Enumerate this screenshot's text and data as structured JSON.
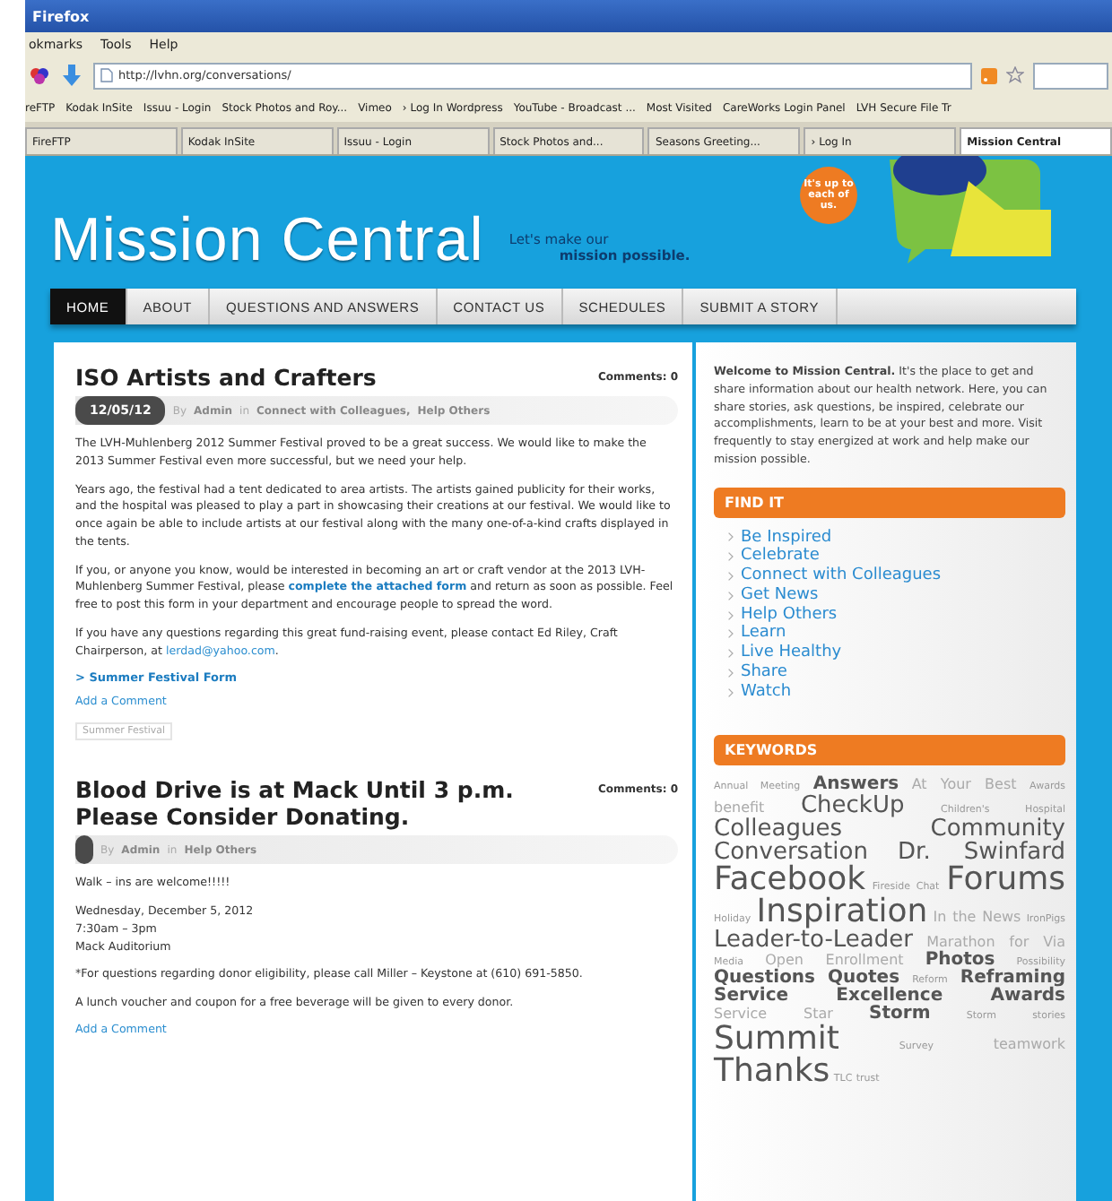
{
  "browser": {
    "title": "Firefox",
    "menu": [
      "okmarks",
      "Tools",
      "Help"
    ],
    "address": "http://lvhn.org/conversations/",
    "bookmarks": [
      "reFTP",
      "Kodak InSite",
      "Issuu - Login",
      "Stock Photos and Roy...",
      "Vimeo",
      "› Log In Wordpress",
      "YouTube - Broadcast ...",
      "Most Visited",
      "CareWorks Login Panel",
      "LVH Secure File Tr"
    ],
    "tabs": [
      {
        "label": "FireFTP",
        "selected": false
      },
      {
        "label": "Kodak InSite",
        "selected": false
      },
      {
        "label": "Issuu - Login",
        "selected": false
      },
      {
        "label": "Stock Photos and...",
        "selected": false
      },
      {
        "label": "Seasons Greeting...",
        "selected": false
      },
      {
        "label": "› Log In",
        "selected": false
      },
      {
        "label": "Mission Central",
        "selected": true
      }
    ]
  },
  "header": {
    "title": "Mission Central",
    "tagline_1": "Let's make our",
    "tagline_2": "mission possible.",
    "bubble": "It's up to each of us."
  },
  "nav": [
    {
      "label": "HOME",
      "selected": true
    },
    {
      "label": "ABOUT",
      "selected": false
    },
    {
      "label": "QUESTIONS AND ANSWERS",
      "selected": false
    },
    {
      "label": "CONTACT US",
      "selected": false
    },
    {
      "label": "SCHEDULES",
      "selected": false
    },
    {
      "label": "SUBMIT A STORY",
      "selected": false
    }
  ],
  "posts": [
    {
      "title": "ISO Artists and Crafters",
      "comments": "Comments: 0",
      "date": "12/05/12",
      "by": "By",
      "author": "Admin",
      "in": "in",
      "categories": [
        "Connect with Colleagues,",
        "Help Others"
      ],
      "paragraphs": [
        {
          "lines": [
            [
              {
                "kind": "text",
                "text": "The LVH-Muhlenberg 2012 Summer Festival proved to be a great success. We would like to make the 2013 Summer Festival even more successful, but we need your help."
              }
            ]
          ]
        },
        {
          "lines": [
            [
              {
                "kind": "text",
                "text": "Years ago, the festival had a tent dedicated to area artists. The artists gained publicity for their works, and the hospital was pleased to play a part in showcasing their creations at our festival. We would like to once again be able to include artists at our festival along with the many one-of-a-kind crafts displayed in the tents."
              }
            ]
          ]
        },
        {
          "lines": [
            [
              {
                "kind": "text",
                "text": "If you, or anyone you know, would be interested in becoming an art or craft vendor at the 2013 LVH-Muhlenberg Summer Festival, please "
              },
              {
                "kind": "link",
                "text": "complete the attached form"
              },
              {
                "kind": "text",
                "text": " and return as soon as possible. Feel free to post this form in your department and encourage people to spread the word."
              }
            ]
          ]
        },
        {
          "lines": [
            [
              {
                "kind": "text",
                "text": "If you have any questions regarding this great fund-raising event, please contact Ed Riley, Craft Chairperson, at "
              },
              {
                "kind": "link",
                "text": "lerdad@yahoo.com"
              },
              {
                "kind": "text",
                "text": "."
              }
            ]
          ]
        }
      ],
      "form_link": "> Summer Festival Form",
      "add_comment": "Add a Comment",
      "tag": "Summer Festival"
    },
    {
      "title": "Blood Drive is at Mack Until 3 p.m. Please Consider Donating.",
      "comments": "Comments: 0",
      "by": "By",
      "author": "Admin",
      "in": "in",
      "categories": [
        "Help Others"
      ],
      "paragraphs": [
        {
          "lines": [
            [
              {
                "kind": "text",
                "text": "Walk – ins are welcome!!!!!"
              }
            ]
          ]
        },
        {
          "lines": [
            [
              {
                "kind": "text",
                "text": "Wednesday, December 5, 2012"
              }
            ],
            [
              {
                "kind": "text",
                "text": "7:30am – 3pm"
              }
            ],
            [
              {
                "kind": "text",
                "text": "Mack Auditorium"
              }
            ]
          ]
        },
        {
          "lines": [
            [
              {
                "kind": "text",
                "text": "*For questions regarding donor eligibility, please call Miller – Keystone at (610) 691-5850."
              }
            ]
          ]
        },
        {
          "lines": [
            [
              {
                "kind": "text",
                "text": "A lunch voucher and coupon for a free beverage will be given to every donor."
              }
            ]
          ]
        }
      ],
      "add_comment": "Add a Comment"
    }
  ],
  "sidebar": {
    "welcome": "**Welcome to Mission Central.** It's the place to get and share information about our health network. Here, you can share stories, ask questions, be inspired, celebrate our accomplishments, learn to be at your best and more. Visit frequently to stay energized at work and help make our mission possible.",
    "find_it": {
      "heading": "FIND IT",
      "items": [
        "Be Inspired",
        "Celebrate",
        "Connect with Colleagues",
        "Get News",
        "Help Others",
        "Learn",
        "Live Healthy",
        "Share",
        "Watch"
      ]
    },
    "keywords": {
      "heading": "KEYWORDS",
      "tags": [
        {
          "text": "Annual Meeting",
          "kind": "xs"
        },
        {
          "text": "Answers",
          "kind": "m"
        },
        {
          "text": "At Your Best",
          "kind": "s"
        },
        {
          "text": "Awards",
          "kind": "xs"
        },
        {
          "text": "benefit",
          "kind": "s"
        },
        {
          "text": "CheckUp",
          "kind": "l"
        },
        {
          "text": "Children's Hospital",
          "kind": "xs"
        },
        {
          "text": "Colleagues",
          "kind": "l"
        },
        {
          "text": "Community",
          "kind": "l"
        },
        {
          "text": "Conversation",
          "kind": "l"
        },
        {
          "text": "Dr. Swinfard",
          "kind": "l"
        },
        {
          "text": "Facebook",
          "kind": "xl"
        },
        {
          "text": "Fireside Chat",
          "kind": "xs"
        },
        {
          "text": "Forums",
          "kind": "xl"
        },
        {
          "text": "Holiday",
          "kind": "xs"
        },
        {
          "text": "Inspiration",
          "kind": "xl"
        },
        {
          "text": "In the News",
          "kind": "s"
        },
        {
          "text": "IronPigs",
          "kind": "xs"
        },
        {
          "text": "Leader-to-Leader",
          "kind": "l"
        },
        {
          "text": "Marathon for Via",
          "kind": "s"
        },
        {
          "text": "Media",
          "kind": "xs"
        },
        {
          "text": "Open Enrollment",
          "kind": "s"
        },
        {
          "text": "Photos",
          "kind": "m"
        },
        {
          "text": "Possibility",
          "kind": "xs"
        },
        {
          "text": "Questions",
          "kind": "m"
        },
        {
          "text": "Quotes",
          "kind": "m"
        },
        {
          "text": "Reform",
          "kind": "xs"
        },
        {
          "text": "Reframing",
          "kind": "m"
        },
        {
          "text": "Service Excellence Awards",
          "kind": "m"
        },
        {
          "text": "Service Star",
          "kind": "s"
        },
        {
          "text": "Storm",
          "kind": "m"
        },
        {
          "text": "Storm",
          "kind": "xs"
        },
        {
          "text": "stories",
          "kind": "xs"
        },
        {
          "text": "Summit",
          "kind": "xl"
        },
        {
          "text": "Survey",
          "kind": "xs"
        },
        {
          "text": "teamwork",
          "kind": "s"
        },
        {
          "text": "Thanks",
          "kind": "xl"
        },
        {
          "text": "TLC",
          "kind": "xs"
        },
        {
          "text": "trust",
          "kind": "xs"
        }
      ]
    }
  }
}
